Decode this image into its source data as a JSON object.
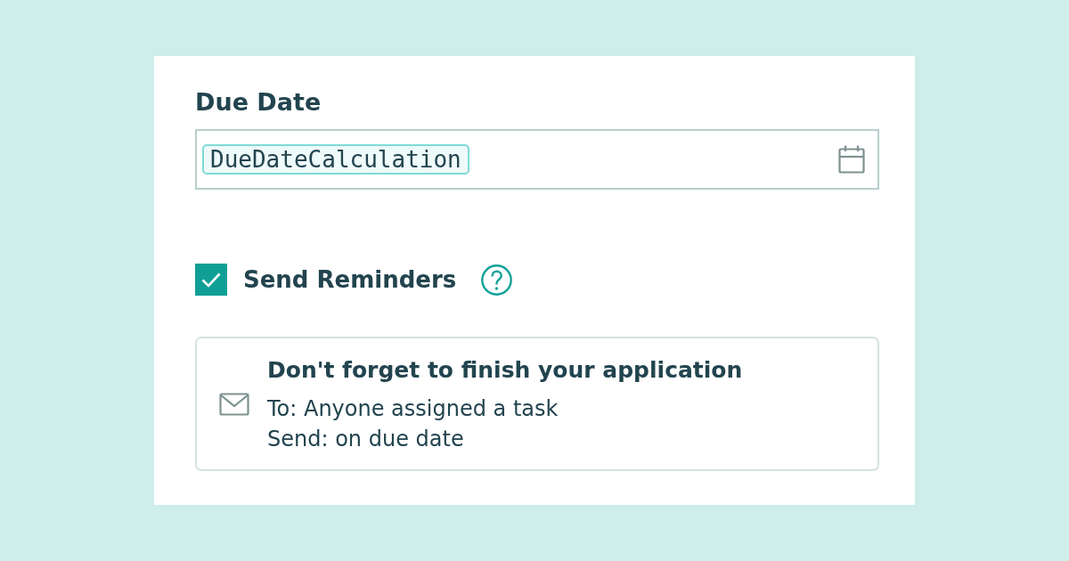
{
  "due_date": {
    "label": "Due Date",
    "token": "DueDateCalculation"
  },
  "send_reminders": {
    "label": "Send Reminders",
    "checked": true
  },
  "reminder": {
    "title": "Don't forget to finish your application",
    "lines": [
      "To: Anyone assigned a task",
      "Send: on due date"
    ]
  }
}
